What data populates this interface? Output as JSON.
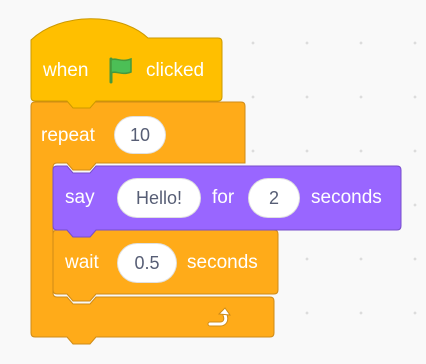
{
  "colors": {
    "events": "#ffbf00",
    "events_border": "#cc9900",
    "control": "#ffab19",
    "control_border": "#cf8b17",
    "looks": "#9966ff",
    "looks_border": "#774dcb",
    "flag": "#4cbf56"
  },
  "hat": {
    "when_label": "when",
    "icon": "green-flag-icon",
    "clicked_label": "clicked"
  },
  "repeat": {
    "label": "repeat",
    "count": "10",
    "icon": "loop-arrow-icon"
  },
  "say": {
    "label": "say",
    "message": "Hello!",
    "for_label": "for",
    "secs": "2",
    "seconds_label": "seconds"
  },
  "wait": {
    "label": "wait",
    "secs": "0.5",
    "seconds_label": "seconds"
  }
}
